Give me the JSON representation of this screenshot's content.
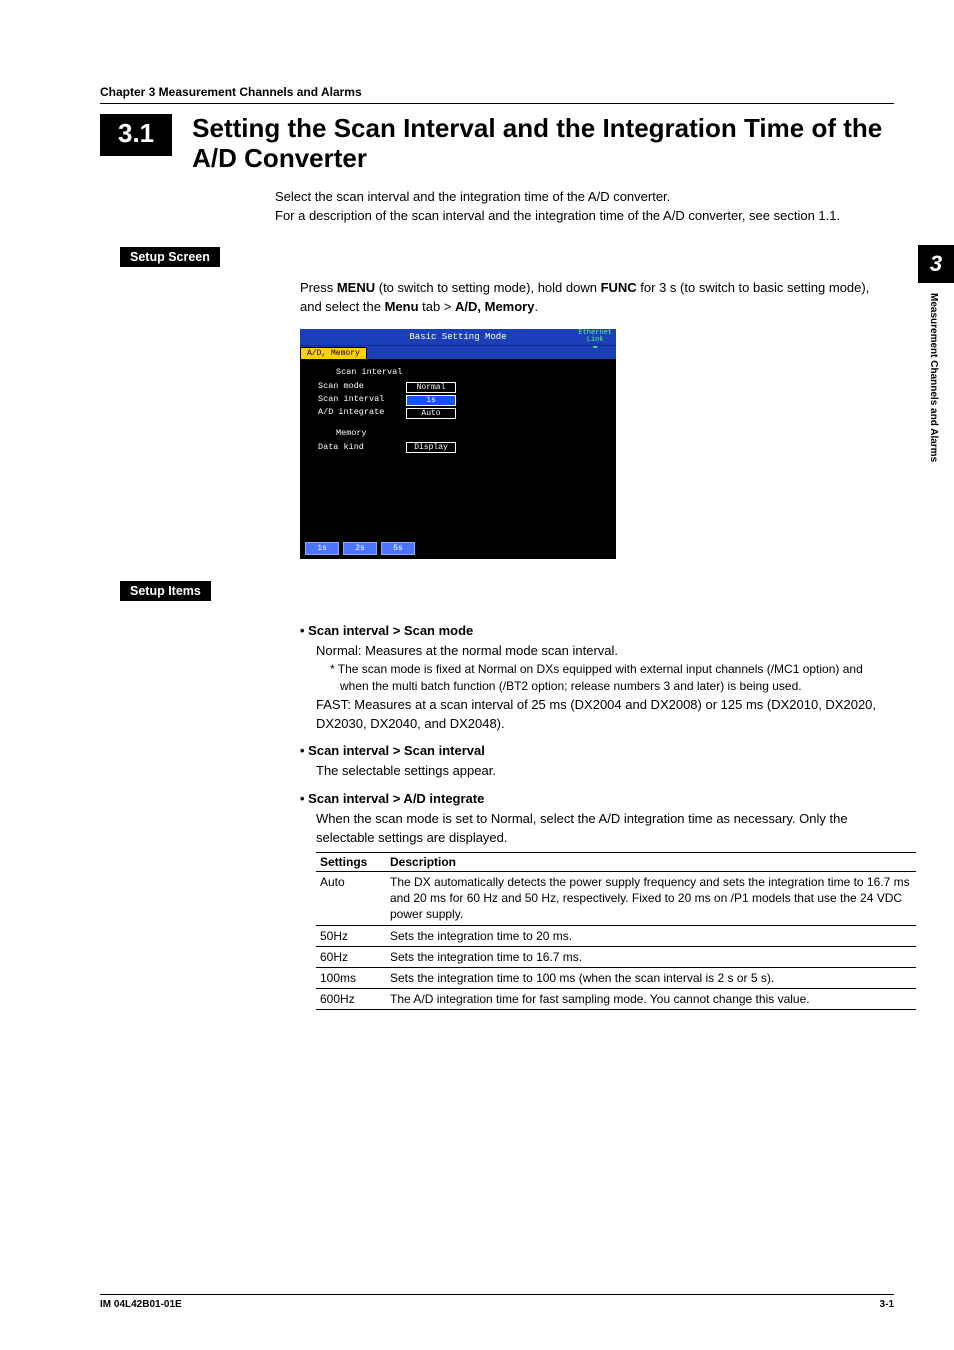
{
  "chapter_line": "Chapter 3    Measurement Channels and Alarms",
  "section_number": "3.1",
  "section_title": "Setting the Scan Interval and the Integration Time of the A/D Converter",
  "intro_line1": "Select the scan interval and the integration time of the A/D converter.",
  "intro_line2": "For a description of the scan interval and the integration time of the A/D converter, see section 1.1.",
  "setup_screen_heading": "Setup Screen",
  "setup_screen_text_pre": "Press ",
  "setup_screen_menu": "MENU",
  "setup_screen_text_mid1": " (to switch to setting mode), hold down ",
  "setup_screen_func": "FUNC",
  "setup_screen_text_mid2": " for 3 s (to switch to basic setting mode), and select the ",
  "setup_screen_menutab": "Menu",
  "setup_screen_text_mid3": " tab > ",
  "setup_screen_admem": "A/D, Memory",
  "setup_screen_text_end": ".",
  "screenshot": {
    "titlebar": "Basic Setting Mode",
    "ethernet": "Ethernet Link",
    "tab_active": "A/D, Memory",
    "group1_label": "Scan interval",
    "row1_label": "Scan mode",
    "row1_value": "Normal",
    "row2_label": "Scan interval",
    "row2_value": "1s",
    "row3_label": "A/D integrate",
    "row3_value": "Auto",
    "group2_label": "Memory",
    "row4_label": "Data kind",
    "row4_value": "Display",
    "fb1": "1s",
    "fb2": "2s",
    "fb3": "5s"
  },
  "setup_items_heading": "Setup Items",
  "item1_title": "Scan interval > Scan mode",
  "item1_body1": "Normal: Measures at the normal mode scan interval.",
  "item1_note": "The scan mode is fixed at Normal on DXs equipped with external input channels (/MC1 option) and when the multi batch function (/BT2 option; release numbers 3 and later) is being used.",
  "item1_body2": "FAST: Measures at a scan interval of 25 ms (DX2004 and DX2008) or 125 ms (DX2010, DX2020, DX2030, DX2040, and DX2048).",
  "item2_title": "Scan interval > Scan interval",
  "item2_body": "The selectable settings appear.",
  "item3_title": "Scan interval > A/D integrate",
  "item3_body_pre": "When the scan mode is set to ",
  "item3_body_bold": "Normal",
  "item3_body_post": ", select the A/D integration time as necessary. Only the selectable settings are displayed.",
  "table": {
    "h1": "Settings",
    "h2": "Description",
    "rows": [
      {
        "s": "Auto",
        "d": "The DX automatically detects the power supply frequency and sets the integration time to 16.7 ms and 20 ms for 60 Hz and 50 Hz, respectively. Fixed to 20 ms on /P1 models that use the 24 VDC power supply."
      },
      {
        "s": "50Hz",
        "d": "Sets the integration time to 20 ms."
      },
      {
        "s": "60Hz",
        "d": "Sets the integration time to 16.7 ms."
      },
      {
        "s": "100ms",
        "d": "Sets the integration time to 100 ms (when the scan interval is 2 s or 5 s)."
      },
      {
        "s": "600Hz",
        "d": "The A/D integration time for fast sampling mode. You cannot change this value."
      }
    ]
  },
  "side_tab_num": "3",
  "side_tab_text": "Measurement Channels and Alarms",
  "footer_left": "IM 04L42B01-01E",
  "footer_right": "3-1"
}
